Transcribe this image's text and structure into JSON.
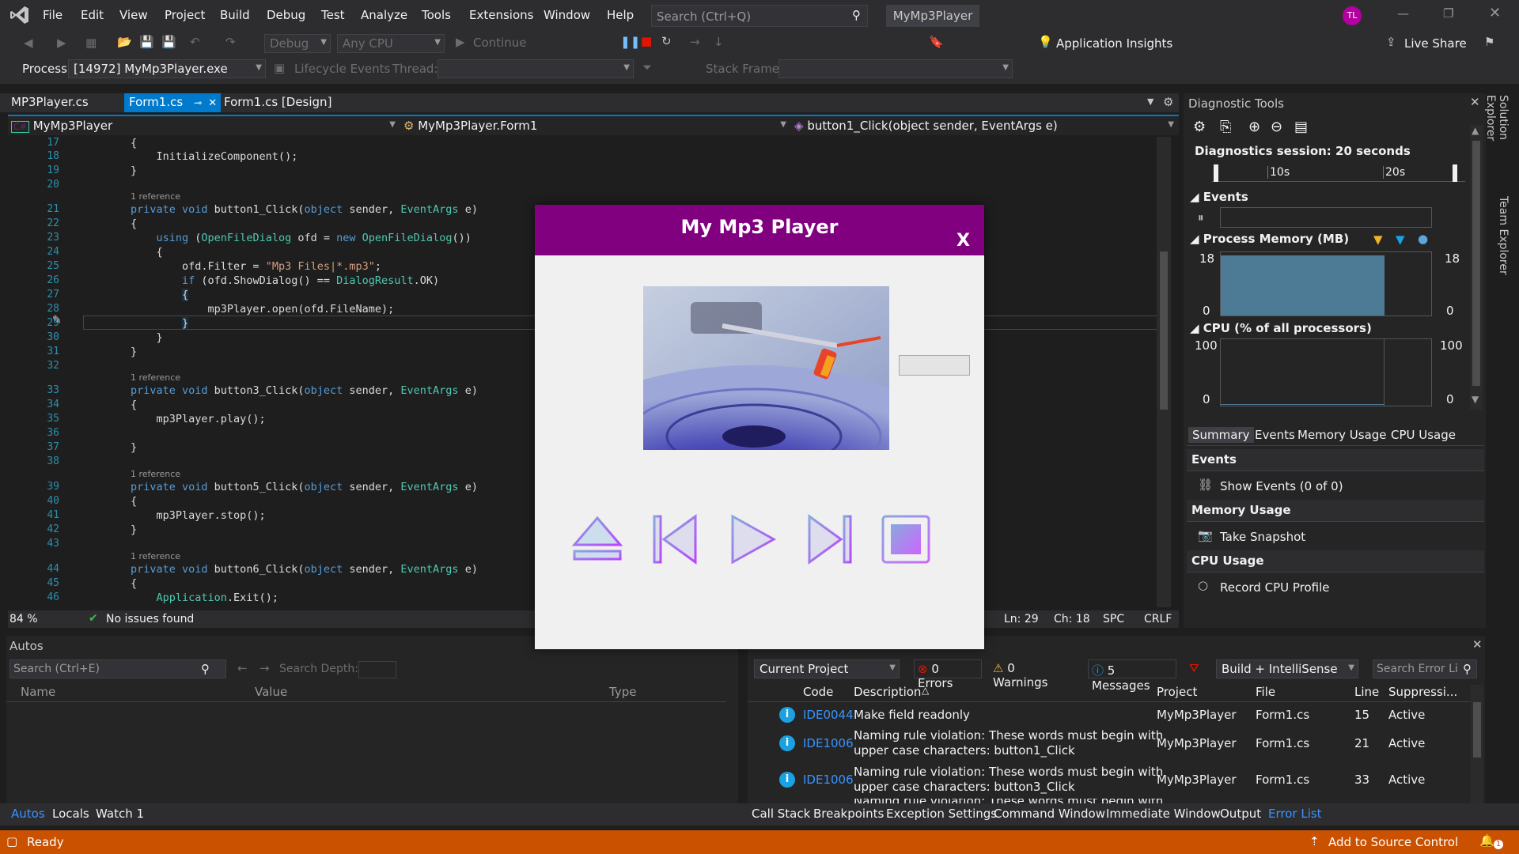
{
  "menubar": {
    "items": [
      "File",
      "Edit",
      "View",
      "Project",
      "Build",
      "Debug",
      "Test",
      "Analyze",
      "Tools",
      "Extensions",
      "Window",
      "Help"
    ],
    "search_placeholder": "Search (Ctrl+Q)",
    "solution_name": "MyMp3Player",
    "user_initials": "TL"
  },
  "toolbar": {
    "config": "Debug",
    "platform": "Any CPU",
    "continue_label": "Continue",
    "app_insights": "Application Insights",
    "live_share": "Live Share"
  },
  "debugbar": {
    "process_label": "Process:",
    "process_value": "[14972] MyMp3Player.exe",
    "lifecycle": "Lifecycle Events",
    "thread_label": "Thread:",
    "stack_label": "Stack Frame:"
  },
  "tabs": [
    {
      "label": "MP3Player.cs"
    },
    {
      "label": "Form1.cs"
    },
    {
      "label": "Form1.cs [Design]"
    }
  ],
  "navbar": {
    "project": "MyMp3Player",
    "class": "MyMp3Player.Form1",
    "member": "button1_Click(object sender, EventArgs e)"
  },
  "code_lines": [
    "17",
    "18",
    "19",
    "20",
    "21",
    "22",
    "23",
    "24",
    "25",
    "26",
    "27",
    "28",
    "29",
    "30",
    "31",
    "32",
    "33",
    "34",
    "35",
    "36",
    "37",
    "38",
    "39",
    "40",
    "41",
    "42",
    "43",
    "44",
    "45",
    "46"
  ],
  "code_ref": "1 reference",
  "editor_status": {
    "zoom": "84 %",
    "issues": "No issues found",
    "ln": "Ln: 29",
    "ch": "Ch: 18",
    "spc": "SPC",
    "crlf": "CRLF"
  },
  "diagnostics": {
    "title": "Diagnostic Tools",
    "session": "Diagnostics session: 20 seconds",
    "tick_10": "10s",
    "tick_20": "20s",
    "events_header": "Events",
    "memory_header": "Process Memory (MB)",
    "memory_max": "18",
    "memory_min": "0",
    "cpu_header": "CPU (% of all processors)",
    "cpu_max": "100",
    "cpu_min": "0",
    "tabs": [
      "Summary",
      "Events",
      "Memory Usage",
      "CPU Usage"
    ],
    "summary": {
      "events_title": "Events",
      "show_events": "Show Events (0 of 0)",
      "memory_title": "Memory Usage",
      "take_snapshot": "Take Snapshot",
      "cpu_title": "CPU Usage",
      "record_cpu": "Record CPU Profile"
    },
    "side_tabs": [
      "Solution Explorer",
      "Team Explorer"
    ]
  },
  "autos": {
    "title": "Autos",
    "search_placeholder": "Search (Ctrl+E)",
    "search_depth": "Search Depth:",
    "columns": [
      "Name",
      "Value",
      "Type"
    ]
  },
  "errors": {
    "scope": "Current Project",
    "errors_count": "0 Errors",
    "warnings_count": "0 Warnings",
    "messages_count": "5 Messages",
    "filter": "Build + IntelliSense",
    "search_placeholder": "Search Error Li",
    "columns": [
      "Code",
      "Description",
      "Project",
      "File",
      "Line",
      "Suppressi..."
    ],
    "rows": [
      {
        "code": "IDE0044",
        "desc1": "Make field readonly",
        "desc2": "",
        "project": "MyMp3Player",
        "file": "Form1.cs",
        "line": "15",
        "supp": "Active"
      },
      {
        "code": "IDE1006",
        "desc1": "Naming rule violation: These words must begin with",
        "desc2": "upper case characters: button1_Click",
        "project": "MyMp3Player",
        "file": "Form1.cs",
        "line": "21",
        "supp": "Active"
      },
      {
        "code": "IDE1006",
        "desc1": "Naming rule violation: These words must begin with",
        "desc2": "upper case characters: button3_Click",
        "project": "MyMp3Player",
        "file": "Form1.cs",
        "line": "33",
        "supp": "Active"
      }
    ],
    "cut_row": "Naming rule violation: These words must begin with"
  },
  "bottom_tabs_left": [
    "Autos",
    "Locals",
    "Watch 1"
  ],
  "bottom_tabs_right": [
    "Call Stack",
    "Breakpoints",
    "Exception Settings",
    "Command Window",
    "Immediate Window",
    "Output",
    "Error List"
  ],
  "statusbar": {
    "ready": "Ready",
    "source_control": "Add to Source Control",
    "notifications": "1"
  },
  "player": {
    "title": "My Mp3 Player",
    "close": "X",
    "buttons": [
      "eject",
      "previous",
      "play",
      "next",
      "stop"
    ]
  },
  "colors": {
    "accent": "#007acc",
    "player_title_bg": "#800080",
    "statusbar": "#ca5100"
  }
}
